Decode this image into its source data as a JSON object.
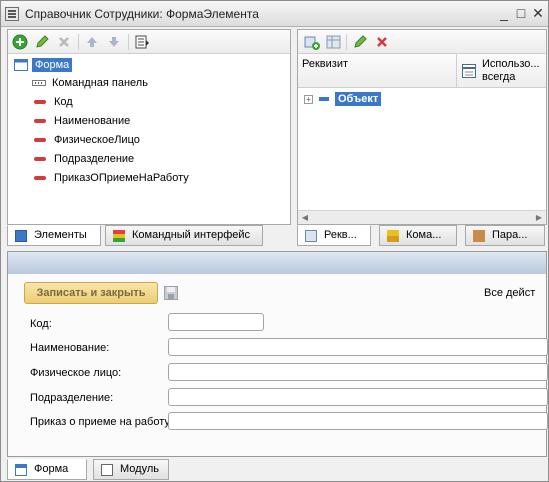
{
  "window": {
    "title": "Справочник Сотрудники: ФормаЭлемента",
    "minimize": "_",
    "maximize": "□",
    "close": "✕"
  },
  "left_pane": {
    "tree_root": "Форма",
    "tree_items": [
      {
        "label": "Командная панель",
        "icon": "command-panel-icon"
      },
      {
        "label": "Код",
        "icon": "field-icon"
      },
      {
        "label": "Наименование",
        "icon": "field-icon"
      },
      {
        "label": "ФизическоеЛицо",
        "icon": "field-icon"
      },
      {
        "label": "Подразделение",
        "icon": "field-icon"
      },
      {
        "label": "ПриказОПриемеНаРаботу",
        "icon": "field-icon"
      }
    ],
    "tabs": [
      "Элементы",
      "Командный интерфейс"
    ]
  },
  "right_pane": {
    "columns": [
      "Реквизит",
      "Использо... всегда"
    ],
    "col_use_line1": "Использо...",
    "col_use_line2": "всегда",
    "tree_item": "Объект",
    "tabs": [
      "Рекв...",
      "Кома...",
      "Пара..."
    ]
  },
  "preview": {
    "save_close_button": "Записать и закрыть",
    "all_actions": "Все дейст",
    "fields": [
      {
        "label": "Код:"
      },
      {
        "label": "Наименование:"
      },
      {
        "label": "Физическое лицо:"
      },
      {
        "label": "Подразделение:"
      },
      {
        "label": "Приказ о приеме на работу:"
      }
    ]
  },
  "bottom_tabs": [
    "Форма",
    "Модуль"
  ],
  "colors": {
    "accent_green": "#3aa335",
    "field_red": "#d13d3d",
    "selection_blue": "#3c78c8",
    "save_button": "#f2d784"
  }
}
